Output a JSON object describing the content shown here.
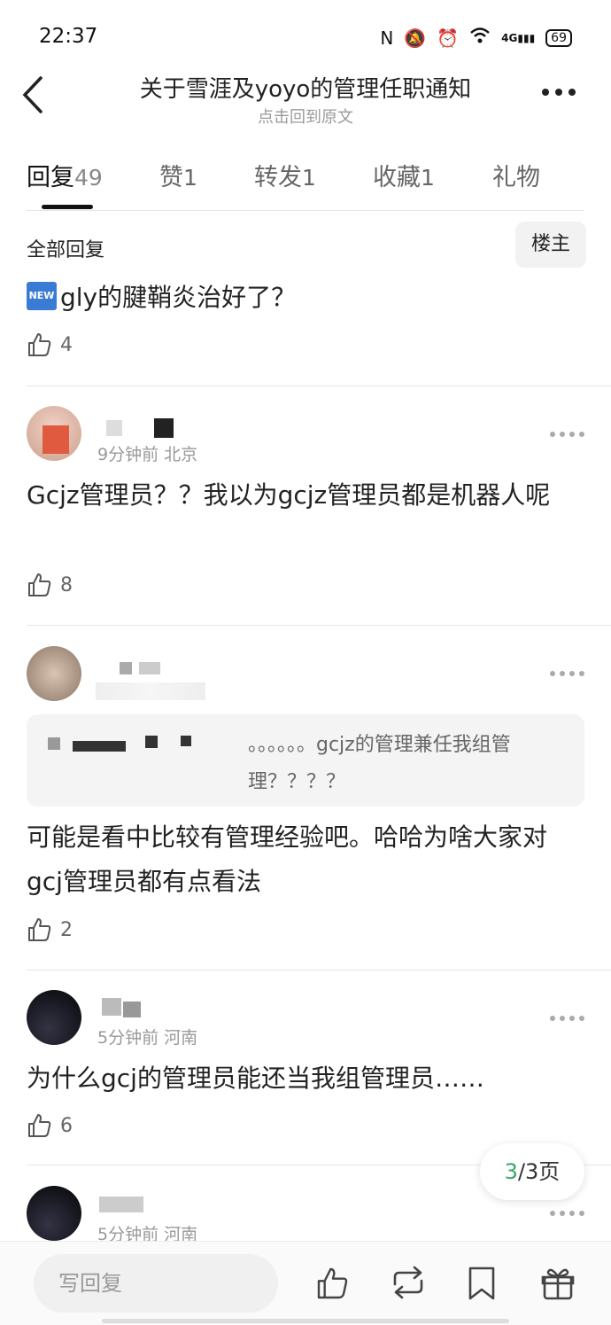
{
  "status_bar": {
    "time": "22:37",
    "network": "4G",
    "battery": "69"
  },
  "nav": {
    "title": "关于雪涯及yoyo的管理任职通知",
    "subtitle": "点击回到原文"
  },
  "tabs": [
    {
      "label": "回复",
      "count": "49"
    },
    {
      "label": "赞",
      "count": "1"
    },
    {
      "label": "转发",
      "count": "1"
    },
    {
      "label": "收藏",
      "count": "1"
    },
    {
      "label": "礼物",
      "count": ""
    }
  ],
  "filter": {
    "label": "全部回复",
    "op_button": "楼主"
  },
  "op_post": {
    "badge": "NEW",
    "text": "gly的腱鞘炎治好了？",
    "likes": "4"
  },
  "replies": [
    {
      "meta": "9分钟前 北京",
      "text": "Gcjz管理员？？我以为gcjz管理员都是机器人呢",
      "likes": "8"
    },
    {
      "meta": "",
      "quote": "。。。。。。gcjz的管理兼任我组管理？？？？",
      "text": "可能是看中比较有管理经验吧。哈哈为啥大家对gcj管理员都有点看法",
      "likes": "2"
    },
    {
      "meta": "5分钟前 河南",
      "text": "为什么gcj的管理员能还当我组管理员……",
      "likes": "6"
    },
    {
      "meta": "5分钟前 河南"
    }
  ],
  "pager": {
    "current": "3",
    "total": "/3页"
  },
  "bottom_bar": {
    "reply_placeholder": "写回复"
  },
  "icons": [
    "back-icon",
    "more-icon",
    "thumbs-up-icon",
    "repost-icon",
    "bookmark-icon",
    "gift-icon"
  ],
  "colors": {
    "accent_green": "#3aa56b",
    "badge_blue": "#3a7bd5"
  }
}
